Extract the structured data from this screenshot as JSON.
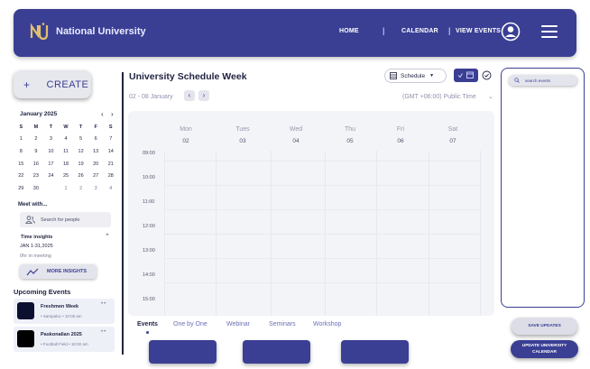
{
  "header": {
    "brand": "National University",
    "nav": [
      "HOME",
      "CALENDAR",
      "VIEW EVENTS"
    ],
    "separator": "|"
  },
  "sidebar": {
    "create_label": "CREATE",
    "create_icon": "plus-icon",
    "calendar": {
      "month": "January 2025",
      "weekdays": [
        "S",
        "M",
        "T",
        "W",
        "T",
        "F",
        "S"
      ],
      "weeks": [
        [
          "1",
          "2",
          "3",
          "4",
          "5",
          "6",
          "7"
        ],
        [
          "8",
          "9",
          "10",
          "11",
          "12",
          "13",
          "14"
        ],
        [
          "15",
          "16",
          "17",
          "18",
          "19",
          "20",
          "21"
        ],
        [
          "22",
          "23",
          "24",
          "25",
          "26",
          "27",
          "28"
        ],
        [
          "29",
          "30",
          "31",
          "1",
          "2",
          "3",
          "4"
        ]
      ],
      "selected_day": "31"
    },
    "meet_label": "Meet with...",
    "search_people_placeholder": "Search for people",
    "time_insights": {
      "label": "Time insights",
      "range": "JAN 1-31,2025",
      "meeting": "0hr in meeting",
      "button": "MORE INSIGHTS"
    },
    "upcoming_title": "Upcoming Events",
    "events": [
      {
        "name": "Freshmen Week",
        "meta": "• Sampaloc   • 10:00 am"
      },
      {
        "name": "Paskonalian 2025",
        "meta": "• Football Field   • 10:00 am"
      }
    ]
  },
  "main": {
    "title": "University Schedule Week",
    "view_select": "Schedule",
    "date_range": "02 - 08 January",
    "timezone": "(GMT +06:00) Public Time",
    "days": [
      {
        "name": "Mon",
        "num": "02"
      },
      {
        "name": "Tues",
        "num": "03"
      },
      {
        "name": "Wed",
        "num": "04"
      },
      {
        "name": "Thu",
        "num": "05"
      },
      {
        "name": "Fri",
        "num": "06"
      },
      {
        "name": "Sat",
        "num": "07"
      }
    ],
    "times": [
      "09:00",
      "10:00",
      "11:00",
      "12:00",
      "13:00",
      "14:00",
      "15:00"
    ],
    "tabs": [
      "Events",
      "One by One",
      "Webinar",
      "Seminars",
      "Workshop"
    ],
    "active_tab": "Events"
  },
  "right_panel": {
    "search_placeholder": "search events",
    "save_label": "SAVE UPDATES",
    "update_label": "UPDATE UNIVERSITY CALENDAR"
  },
  "colors": {
    "primary": "#3a3f94",
    "today": "#2a73e0",
    "panel": "#f3f4f7"
  }
}
